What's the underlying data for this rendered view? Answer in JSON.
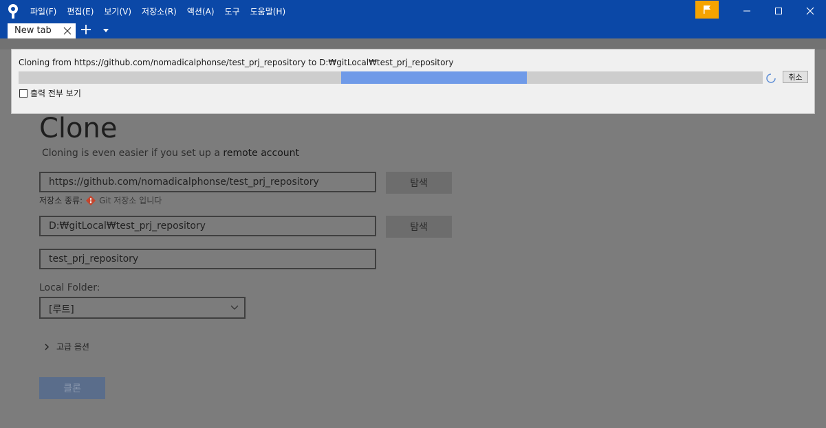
{
  "menu": [
    "파일(F)",
    "편집(E)",
    "보기(V)",
    "저장소(R)",
    "액션(A)",
    "도구",
    "도움말(H)"
  ],
  "tab": {
    "label": "New tab"
  },
  "clone": {
    "title": "Clone",
    "subtitle_prefix": "Cloning is even easier if you set up a ",
    "subtitle_link": "remote account",
    "source_url": "https://github.com/nomadicalphonse/test_prj_repository",
    "browse_label": "탐색",
    "repo_type_label": "저장소 종류:",
    "repo_type_value": "Git 저장소 입니다",
    "destination_path": "D:₩gitLocal₩test_prj_repository",
    "name": "test_prj_repository",
    "local_folder_label": "Local Folder:",
    "local_folder_value": "[루트]",
    "advanced_label": "고급 옵션",
    "clone_button": "클론"
  },
  "dialog": {
    "message": "Cloning from https://github.com/nomadicalphonse/test_prj_repository to D:₩gitLocal₩test_prj_repository",
    "cancel_label": "취소",
    "show_output_label": "출력 전부 보기",
    "progress": {
      "start": 0.433,
      "end": 0.683
    }
  },
  "colors": {
    "titlebar": "#0b48a7",
    "flag": "#f5a300",
    "progress_fill": "#6f9ae8",
    "git_icon": "#f05033"
  }
}
